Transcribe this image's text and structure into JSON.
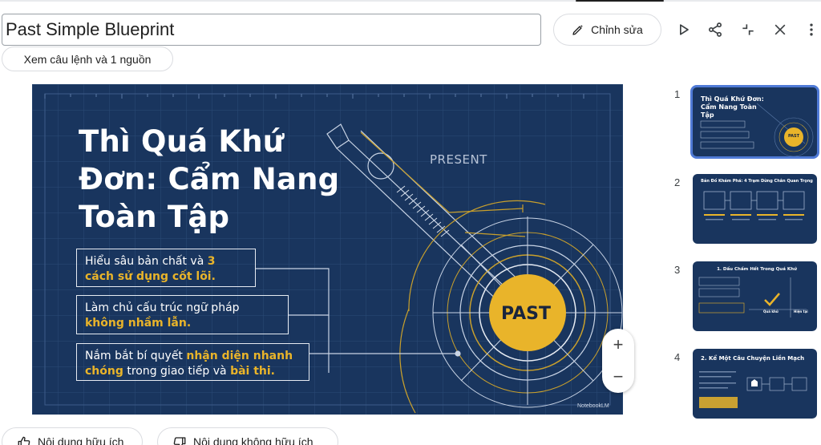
{
  "header": {
    "title_value": "Past Simple Blueprint",
    "edit_label": "Chỉnh sửa",
    "sources_label": "Xem câu lệnh và 1 nguồn"
  },
  "toolbar_icons": [
    "pencil-icon",
    "play-icon",
    "share-icon",
    "collapse-icon",
    "close-icon",
    "more-vert-icon"
  ],
  "slide": {
    "title": "Thì Quá Khứ Đơn: Cẩm Nang Toàn Tập",
    "callouts": [
      {
        "text": "Hiểu sâu bản chất và ",
        "highlight": "3 cách sử dụng cốt lõi."
      },
      {
        "text": "Làm chủ cấu trúc ngữ pháp ",
        "highlight": "không nhầm lẫn."
      },
      {
        "text_a": "Nắm bắt bí quyết ",
        "highlight_a": "nhận diện nhanh chóng",
        "text_b": " trong giao tiếp và ",
        "highlight_b": "bài thi."
      }
    ],
    "present_label": "PRESENT",
    "past_label": "PAST",
    "watermark": "NotebookLM"
  },
  "zoom": {
    "in": "+",
    "out": "−"
  },
  "thumbnails": [
    {
      "number": "1",
      "title": "Thì Quá Khứ Đơn: Cẩm Nang Toàn Tập",
      "badge": "PAST",
      "selected": true
    },
    {
      "number": "2",
      "title": "Bản Đồ Khám Phá: 4 Trạm Dừng Chân Quan Trọng",
      "selected": false
    },
    {
      "number": "3",
      "title": "1. Dấu Chấm Hết Trong Quá Khứ",
      "labels": [
        "Quá khứ",
        "Hiện tại"
      ],
      "selected": false
    },
    {
      "number": "4",
      "title": "2. Kể Một Câu Chuyện Liền Mạch",
      "selected": false
    }
  ],
  "feedback": {
    "like_label": "Nội dung hữu ích",
    "dislike_label": "Nội dung không hữu ích"
  },
  "colors": {
    "slide_bg": "#19355e",
    "accent_gold": "#e9b42a",
    "selected_border": "#4f7ad6"
  }
}
